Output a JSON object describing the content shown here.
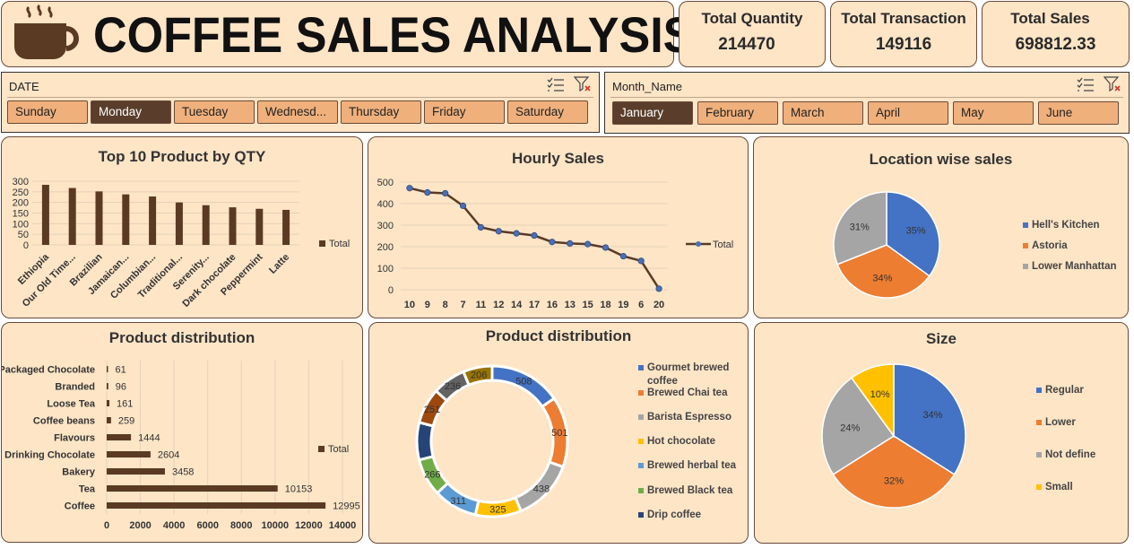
{
  "header": {
    "title": "COFFEE SALES ANALYSIS",
    "logo_icon": "coffee-cup-icon"
  },
  "kpis": [
    {
      "label": "Total Quantity",
      "value": "214470"
    },
    {
      "label": "Total Transaction",
      "value": "149116"
    },
    {
      "label": "Total Sales",
      "value": "698812.33"
    }
  ],
  "slicers": {
    "date": {
      "title": "DATE",
      "options": [
        "Sunday",
        "Monday",
        "Tuesday",
        "Wednesd...",
        "Thursday",
        "Friday",
        "Saturday"
      ],
      "selected": "Monday"
    },
    "month": {
      "title": "Month_Name",
      "options": [
        "January",
        "February",
        "March",
        "April",
        "May",
        "June"
      ],
      "selected": "January"
    },
    "icons": [
      "multi-select-icon",
      "clear-filter-icon"
    ]
  },
  "colors": {
    "bar": "#5b3a24",
    "panel": "#fde5c6",
    "accent_blue": "#4472c4",
    "accent_orange": "#ed7d31",
    "accent_gray": "#a5a5a5",
    "accent_yellow": "#ffc000"
  },
  "chart_data": [
    {
      "type": "bar",
      "title": "Top 10 Product by QTY",
      "categories": [
        "Ethiopia",
        "Our Old Time...",
        "Brazilian",
        "Jamaican...",
        "Columbian...",
        "Traditional...",
        "Serenity...",
        "Dark chocolate",
        "Peppermint",
        "Latte"
      ],
      "series": [
        {
          "name": "Total",
          "values": [
            283,
            268,
            252,
            238,
            228,
            200,
            187,
            177,
            170,
            165
          ]
        }
      ],
      "yticks": [
        "0",
        "50",
        "100",
        "150",
        "200",
        "250",
        "300"
      ],
      "ylim": [
        0,
        300
      ],
      "legend": "right"
    },
    {
      "type": "line",
      "title": "Hourly Sales",
      "categories": [
        "10",
        "9",
        "8",
        "7",
        "11",
        "12",
        "14",
        "17",
        "16",
        "13",
        "15",
        "18",
        "19",
        "6",
        "20"
      ],
      "series": [
        {
          "name": "Total",
          "values": [
            472,
            452,
            448,
            390,
            290,
            272,
            262,
            252,
            222,
            215,
            212,
            196,
            156,
            134,
            5
          ]
        }
      ],
      "yticks": [
        "0",
        "100",
        "200",
        "300",
        "400",
        "500"
      ],
      "ylim": [
        0,
        500
      ],
      "legend": "right"
    },
    {
      "type": "pie",
      "title": "Location wise sales",
      "labels": [
        "Hell's Kitchen",
        "Astoria",
        "Lower Manhattan"
      ],
      "values": [
        35,
        34,
        31
      ],
      "value_labels": [
        "35%",
        "34%",
        "31%"
      ],
      "legend": "right"
    },
    {
      "type": "bar",
      "orientation": "horizontal",
      "title": "Product distribution",
      "categories": [
        "Packaged Chocolate",
        "Branded",
        "Loose Tea",
        "Coffee beans",
        "Flavours",
        "Drinking Chocolate",
        "Bakery",
        "Tea",
        "Coffee"
      ],
      "series": [
        {
          "name": "Total",
          "values": [
            61,
            96,
            161,
            259,
            1444,
            2604,
            3458,
            10153,
            12995
          ]
        }
      ],
      "xticks": [
        "0",
        "2000",
        "4000",
        "6000",
        "8000",
        "10000",
        "12000",
        "14000"
      ],
      "xlim": [
        0,
        14000
      ],
      "legend": "right"
    },
    {
      "type": "pie",
      "title": "Product distribution",
      "donut": true,
      "labels": [
        "Gourmet brewed coffee",
        "Brewed Chai tea",
        "Barista Espresso",
        "Hot chocolate",
        "Brewed herbal tea",
        "Brewed Black tea",
        "Drip coffee"
      ],
      "values": [
        508,
        501,
        438,
        325,
        311,
        266,
        265,
        251,
        236,
        206
      ],
      "value_labels": [
        "508",
        "501",
        "438",
        "325",
        "311",
        "266",
        "",
        "251",
        "236",
        "206"
      ],
      "legend": "right"
    },
    {
      "type": "pie",
      "title": "Size",
      "labels": [
        "Regular",
        "Lower",
        "Not define",
        "Small"
      ],
      "values": [
        34,
        32,
        24,
        10
      ],
      "value_labels": [
        "34%",
        "32%",
        "24%",
        "10%"
      ],
      "legend": "right"
    }
  ]
}
